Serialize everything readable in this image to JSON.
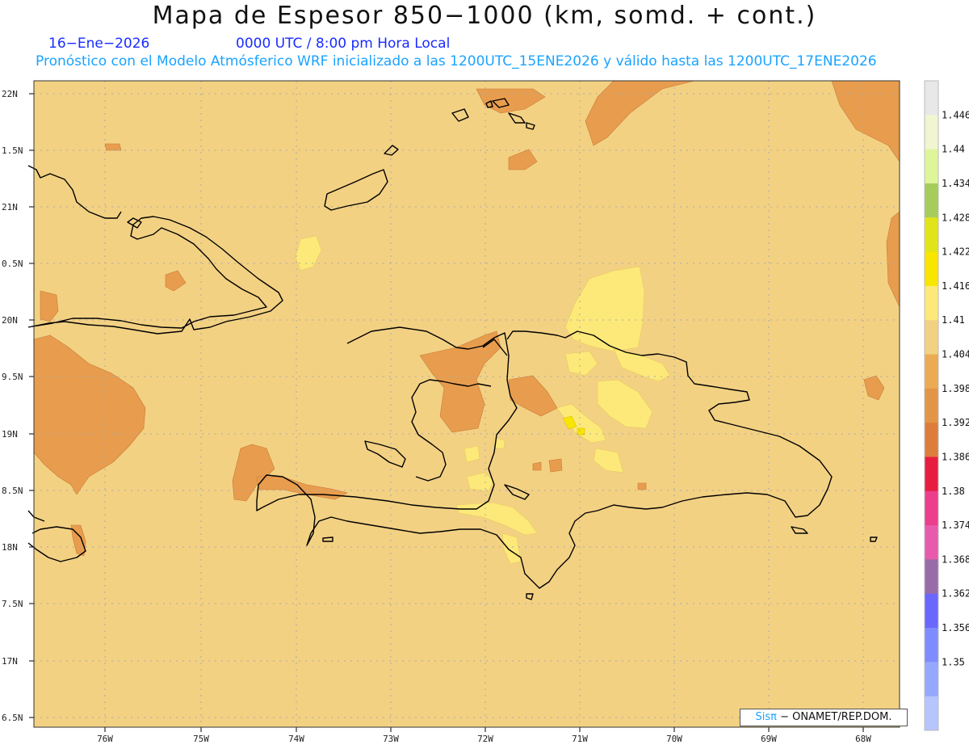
{
  "header": {
    "title": "Mapa de Espesor 850−1000 (km, somd. + cont.)",
    "date": "16−Ene−2026",
    "time": "0000 UTC / 8:00 pm Hora Local",
    "model": "Pronóstico con el Modelo Atmósferico WRF inicializado a las 1200UTC_15ENE2026 y válido hasta las  1200UTC_17ENE2026"
  },
  "axes": {
    "lat_labels": [
      "22N",
      "1.5N",
      "21N",
      "0.5N",
      "20N",
      "9.5N",
      "19N",
      "8.5N",
      "18N",
      "7.5N",
      "17N",
      "6.5N"
    ],
    "lon_labels": [
      "76W",
      "75W",
      "74W",
      "73W",
      "72W",
      "71W",
      "70W",
      "69W",
      "68W"
    ]
  },
  "legend": {
    "levels": [
      "1.446",
      "1.44",
      "1.434",
      "1.428",
      "1.422",
      "1.416",
      "1.41",
      "1.404",
      "1.398",
      "1.392",
      "1.386",
      "1.38",
      "1.374",
      "1.368",
      "1.362",
      "1.356",
      "1.35"
    ],
    "colors": [
      "#e8e8e8",
      "#f1f5d0",
      "#dff59a",
      "#a6cd5c",
      "#e2e41a",
      "#f8e600",
      "#fce97a",
      "#f3d183",
      "#ebab55",
      "#e29547",
      "#dd7d3b",
      "#e71d40",
      "#ec3e8c",
      "#e75aac",
      "#9a6ba9",
      "#6a67ff",
      "#7f8cff",
      "#95a8ff",
      "#b6c4ff"
    ]
  },
  "colors": {
    "background": "#f3d183",
    "low": "#e89d4e",
    "high": "#fce97a",
    "peak": "#f8e600"
  },
  "credit": {
    "brand": "Sisπ",
    "org": "− ONAMET/REP.DOM."
  }
}
